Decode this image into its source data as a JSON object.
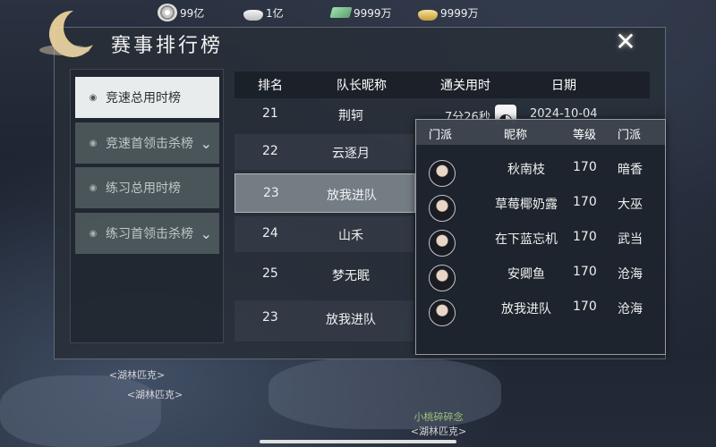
{
  "currencies": [
    {
      "icon": "silver-wheel-icon",
      "value": "99亿"
    },
    {
      "icon": "silver-ingot-icon",
      "value": "1亿"
    },
    {
      "icon": "jade-note-icon",
      "value": "9999万"
    },
    {
      "icon": "gold-ingot-icon",
      "value": "9999万"
    }
  ],
  "title": "赛事排行榜",
  "tabs": [
    {
      "label": "竞速总用时榜",
      "active": true
    },
    {
      "label": "竞速首领击杀榜",
      "active": false,
      "expandable": true
    },
    {
      "label": "练习总用时榜",
      "active": false
    },
    {
      "label": "练习首领击杀榜",
      "active": false,
      "expandable": true
    }
  ],
  "ranking": {
    "headers": {
      "rank": "排名",
      "name": "队长昵称",
      "time": "通关用时",
      "date": "日期"
    },
    "rows": [
      {
        "rank": "21",
        "name": "荆轲",
        "time": "7分26秒",
        "date": "2024-10-04"
      },
      {
        "rank": "22",
        "name": "云逐月"
      },
      {
        "rank": "23",
        "name": "放我进队",
        "selected": true
      },
      {
        "rank": "24",
        "name": "山禾"
      },
      {
        "rank": "25",
        "name": "梦无眠"
      },
      {
        "rank": "23",
        "name": "放我进队"
      }
    ]
  },
  "team_popup": {
    "headers": {
      "school": "门派",
      "name": "昵称",
      "level": "等级",
      "school2": "门派"
    },
    "members": [
      {
        "name": "秋南枝",
        "level": "170",
        "school": "暗香"
      },
      {
        "name": "草莓椰奶露",
        "level": "170",
        "school": "大巫"
      },
      {
        "name": "在下蓝忘机",
        "level": "170",
        "school": "武当"
      },
      {
        "name": "安卿鱼",
        "level": "170",
        "school": "沧海"
      },
      {
        "name": "放我进队",
        "level": "170",
        "school": "沧海"
      }
    ]
  },
  "world": {
    "nameplates": [
      {
        "guild": "<湖林匹克>"
      },
      {
        "guild": "<湖林匹克>"
      },
      {
        "player": "小桃碎碎念",
        "guild": "<湖林匹克>"
      }
    ]
  }
}
